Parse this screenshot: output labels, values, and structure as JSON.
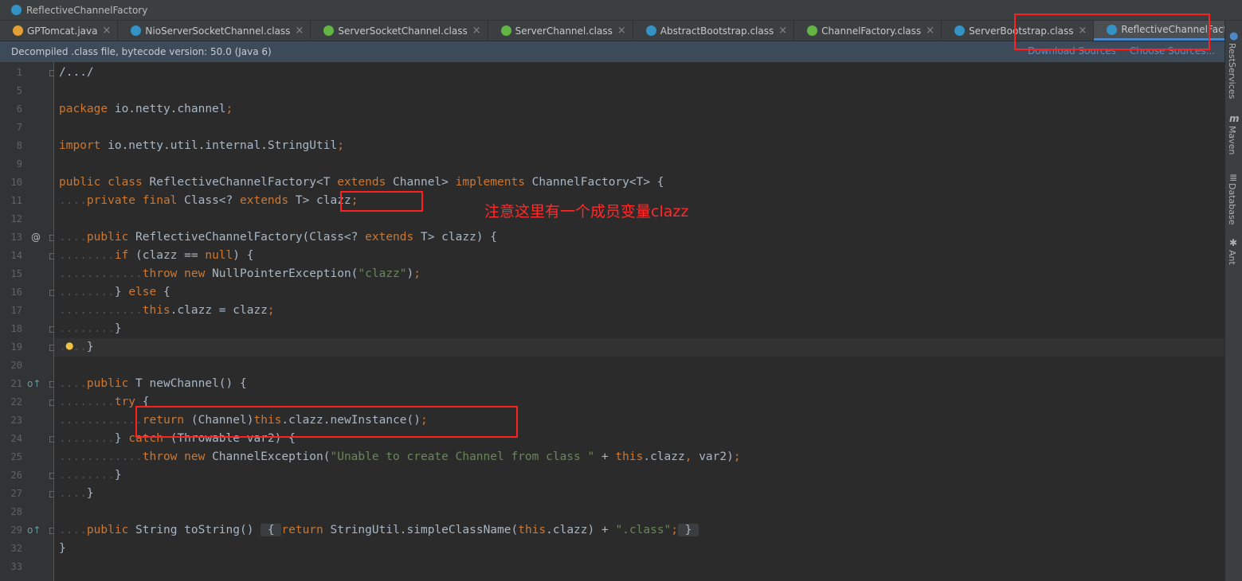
{
  "window": {
    "title": "ReflectiveChannelFactory"
  },
  "tabs": [
    {
      "label": "GPTomcat.java",
      "icon": "java-file-icon",
      "kind": "j"
    },
    {
      "label": "NioServerSocketChannel.class",
      "icon": "class-file-icon",
      "kind": "c"
    },
    {
      "label": "ServerSocketChannel.class",
      "icon": "interface-file-icon",
      "kind": "i"
    },
    {
      "label": "ServerChannel.class",
      "icon": "interface-file-icon",
      "kind": "i"
    },
    {
      "label": "AbstractBootstrap.class",
      "icon": "class-file-icon",
      "kind": "c"
    },
    {
      "label": "ChannelFactory.class",
      "icon": "interface-file-icon",
      "kind": "i"
    },
    {
      "label": "ServerBootstrap.class",
      "icon": "class-file-icon",
      "kind": "c"
    },
    {
      "label": "ReflectiveChannelFactory.class",
      "icon": "class-file-icon",
      "kind": "c",
      "active": true
    }
  ],
  "banner": {
    "message": "Decompiled .class file, bytecode version: 50.0 (Java 6)",
    "download_sources": "Download Sources",
    "choose_sources": "Choose Sources..."
  },
  "annotation": {
    "text": "注意这里有一个成员变量clazz"
  },
  "right_tools": [
    {
      "label": "RestServices",
      "icon": "globe-icon"
    },
    {
      "label": "Maven",
      "icon": "maven-icon"
    },
    {
      "label": "Database",
      "icon": "database-icon"
    },
    {
      "label": "Ant",
      "icon": "ant-icon"
    }
  ],
  "code_lines": [
    {
      "num": "1",
      "html": "/.../",
      "fold": true
    },
    {
      "num": "5",
      "html": ""
    },
    {
      "num": "6",
      "html": "<span class='kw'>package</span> io.netty.channel<span class='kw'>;</span>"
    },
    {
      "num": "7",
      "html": ""
    },
    {
      "num": "8",
      "html": "<span class='kw'>import</span> io.netty.util.internal.StringUtil<span class='kw'>;</span>"
    },
    {
      "num": "9",
      "html": ""
    },
    {
      "num": "10",
      "html": "<span class='kw'>public class</span> ReflectiveChannelFactory&lt;T <span class='kw'>extends</span> Channel&gt; <span class='kw'>implements</span> ChannelFactory&lt;T&gt; {"
    },
    {
      "num": "11",
      "html": "<span class='ws'>....</span><span class='kw'>private final</span> Class&lt;? <span class='kw'>extends</span> T&gt; clazz<span class='kw'>;</span>"
    },
    {
      "num": "12",
      "html": ""
    },
    {
      "num": "13",
      "html": "<span class='ws'>....</span><span class='kw'>public</span> ReflectiveChannelFactory(Class&lt;? <span class='kw'>extends</span> T&gt; clazz) {",
      "mark": "@",
      "fold": true
    },
    {
      "num": "14",
      "html": "<span class='ws'>........</span><span class='kw'>if</span> (clazz == <span class='kw'>null</span>) {",
      "fold": true
    },
    {
      "num": "15",
      "html": "<span class='ws'>............</span><span class='kw'>throw new</span> NullPointerException(<span class='str'>\"clazz\"</span>)<span class='kw'>;</span>"
    },
    {
      "num": "16",
      "html": "<span class='ws'>........</span>} <span class='kw'>else</span> {",
      "fold": true
    },
    {
      "num": "17",
      "html": "<span class='ws'>............</span><span class='kw'>this</span>.clazz = clazz<span class='kw'>;</span>"
    },
    {
      "num": "18",
      "html": "<span class='ws'>........</span>}",
      "fold": true
    },
    {
      "num": "19",
      "html": "<span class='ws'>....</span>}",
      "current": true,
      "bulb": true,
      "fold": true
    },
    {
      "num": "20",
      "html": ""
    },
    {
      "num": "21",
      "html": "<span class='ws'>....</span><span class='kw'>public</span> T newChannel() {",
      "mark": "o↑",
      "fold": true
    },
    {
      "num": "22",
      "html": "<span class='ws'>........</span><span class='kw'>try</span> {",
      "fold": true
    },
    {
      "num": "23",
      "html": "<span class='ws'>............</span><span class='kw'>return</span> (Channel)<span class='kw'>this</span>.clazz.newInstance()<span class='kw'>;</span>"
    },
    {
      "num": "24",
      "html": "<span class='ws'>........</span>} <span class='kw'>catch</span> (Throwable var2) {",
      "fold": true
    },
    {
      "num": "25",
      "html": "<span class='ws'>............</span><span class='kw'>throw new</span> ChannelException(<span class='str'>\"Unable to create Channel from class \"</span> + <span class='kw'>this</span>.clazz<span class='kw'>,</span> var2)<span class='kw'>;</span>"
    },
    {
      "num": "26",
      "html": "<span class='ws'>........</span>}",
      "fold": true
    },
    {
      "num": "27",
      "html": "<span class='ws'>....</span>}",
      "fold": true
    },
    {
      "num": "28",
      "html": ""
    },
    {
      "num": "29",
      "html": "<span class='ws'>....</span><span class='kw'>public</span> String toString() <span class='fold-block'> { </span><span class='kw'>return</span> StringUtil.simpleClassName(<span class='kw'>this</span>.clazz) + <span class='str'>\".class\"</span><span class='kw'>;</span><span class='fold-block'> } </span>",
      "mark": "o↑",
      "fold": true
    },
    {
      "num": "32",
      "html": "}"
    },
    {
      "num": "33",
      "html": ""
    }
  ],
  "colors": {
    "highlight_box": "#ff2020",
    "active_tab_underline": "#4a88c7"
  }
}
